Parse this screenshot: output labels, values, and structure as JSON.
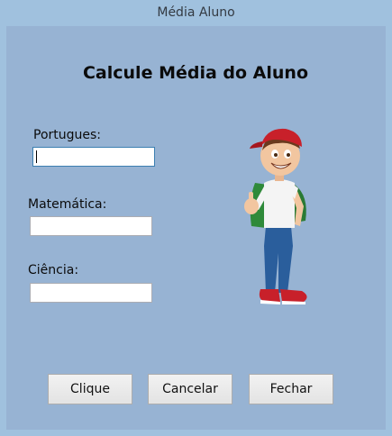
{
  "window": {
    "title": "Média Aluno"
  },
  "form": {
    "heading": "Calcule Média do Aluno",
    "fields": [
      {
        "label": "Portugues:",
        "value": ""
      },
      {
        "label": "Matemática:",
        "value": ""
      },
      {
        "label": "Ciência:",
        "value": ""
      }
    ]
  },
  "buttons": {
    "clique": "Clique",
    "cancelar": "Cancelar",
    "fechar": "Fechar"
  },
  "illustration": {
    "icon": "student-thumbs-up-illustration"
  },
  "colors": {
    "window_frame": "#a0c1de",
    "client_background": "#97b3d3",
    "cap_red": "#c8202a",
    "shirt_white": "#f4f4f4",
    "backpack_green": "#2f8a3a",
    "jeans_blue": "#2a5e9c"
  }
}
